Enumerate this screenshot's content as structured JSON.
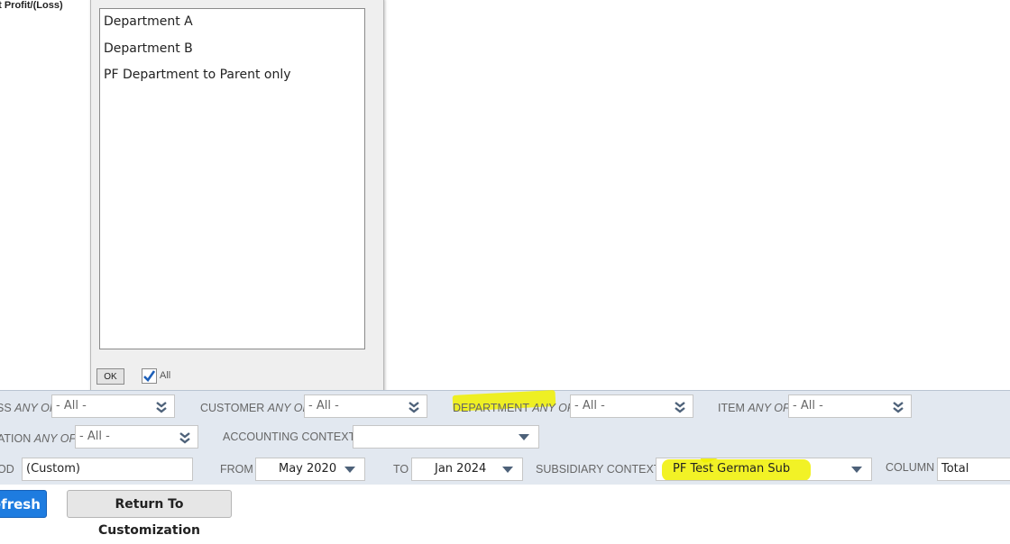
{
  "report": {
    "label": "et Profit/(Loss)"
  },
  "popup": {
    "items": [
      "Department A",
      "Department B",
      "PF Department to Parent only"
    ],
    "ok_label": "OK",
    "all_label": "All",
    "all_checked": true
  },
  "filters": {
    "class": {
      "label": "SS",
      "qualifier": "ANY OF",
      "value": "- All -"
    },
    "customer": {
      "label": "CUSTOMER",
      "qualifier": "ANY OF",
      "value": "- All -"
    },
    "department": {
      "label": "DEPARTMENT",
      "qualifier": "ANY OF",
      "value": "- All -"
    },
    "item": {
      "label": "ITEM",
      "qualifier": "ANY OF",
      "value": "- All -"
    },
    "location": {
      "label": "ATION",
      "qualifier": "ANY OF",
      "value": "- All -"
    },
    "accounting_context": {
      "label": "ACCOUNTING CONTEXT",
      "value": ""
    },
    "period": {
      "label": "OD",
      "value": "(Custom)"
    },
    "from": {
      "label": "FROM",
      "value": "May 2020"
    },
    "to": {
      "label": "TO",
      "value": "Jan 2024"
    },
    "subsidiary_context": {
      "label": "SUBSIDIARY CONTEXT",
      "value": "PF Test German Sub"
    },
    "column": {
      "label": "COLUMN",
      "value": "Total"
    }
  },
  "buttons": {
    "refresh": "efresh",
    "return": "Return To Customization"
  },
  "colors": {
    "highlight": "#f0f000",
    "primary_button": "#1e7ce0",
    "filter_panel": "#e2e8f0"
  }
}
